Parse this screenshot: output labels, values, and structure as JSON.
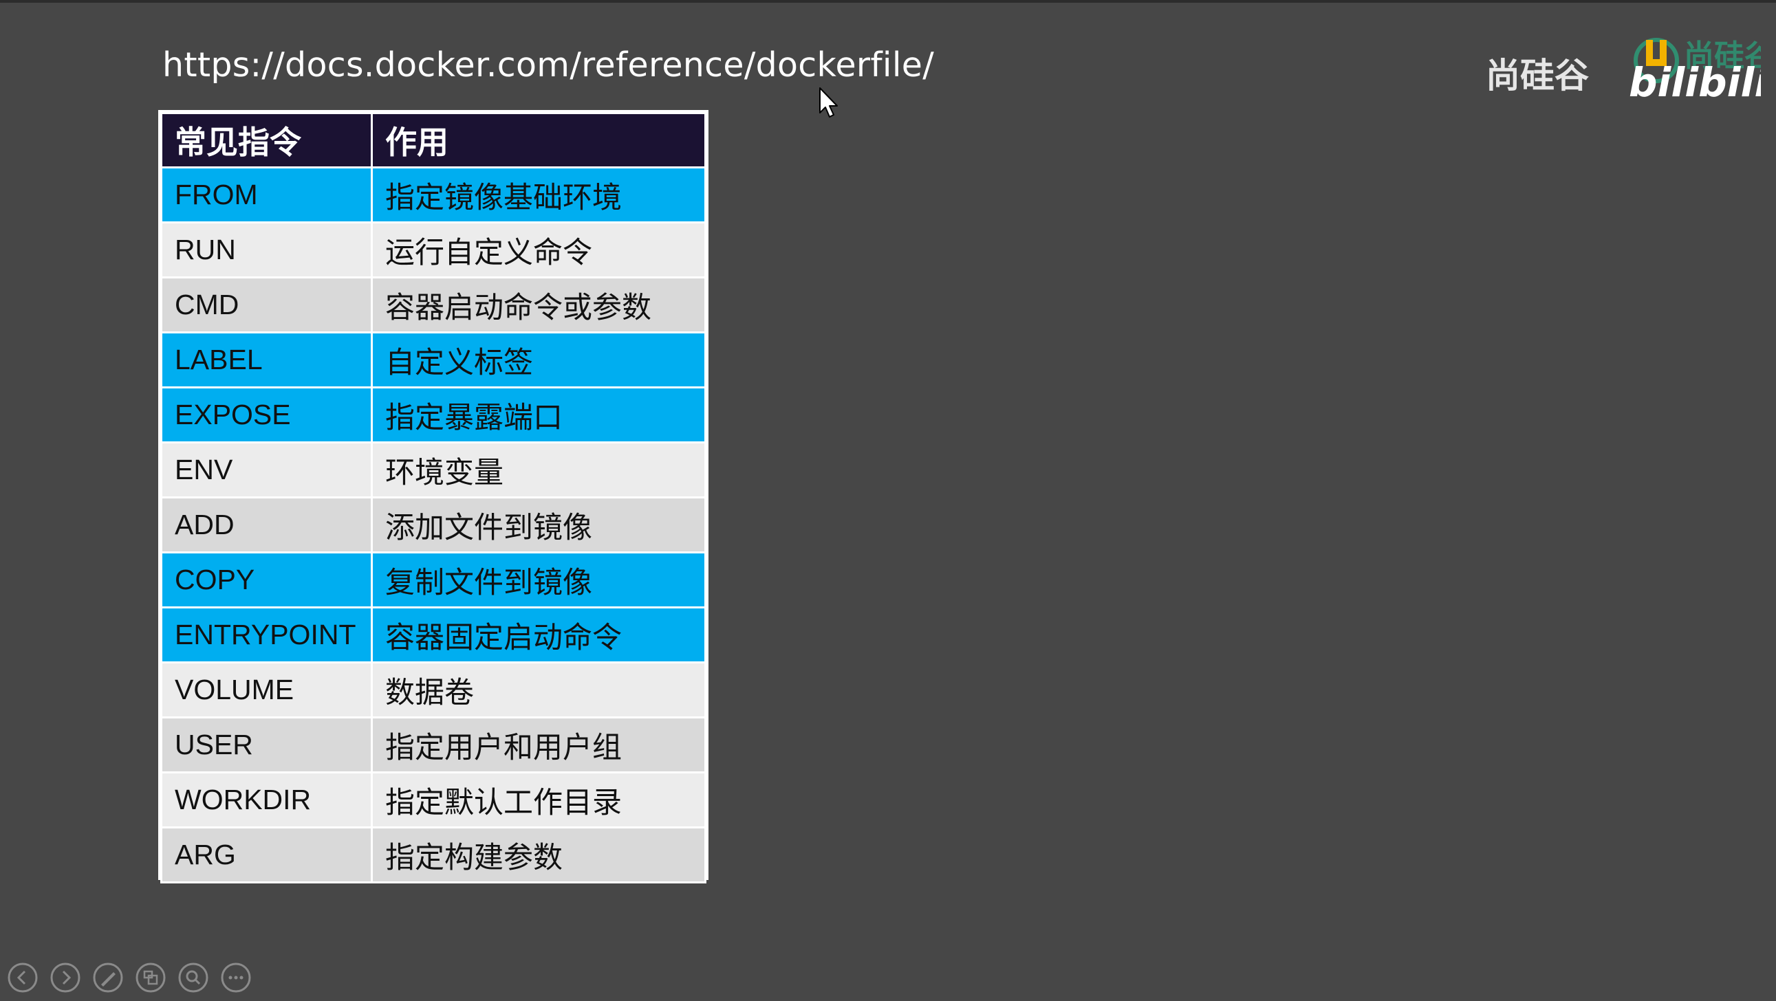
{
  "slide": {
    "url": "https://docs.docker.com/reference/dockerfile/"
  },
  "watermark": {
    "text": "尚硅谷",
    "brand": "bilibili",
    "brand_color": "#ffffff"
  },
  "table": {
    "headers": [
      "常见指令",
      "作用"
    ],
    "header_bg": "#1b1233",
    "highlight_color": "#00aef0",
    "rows": [
      {
        "cmd": "FROM",
        "desc": "指定镜像基础环境",
        "style": "blue"
      },
      {
        "cmd": "RUN",
        "desc": "运行自定义命令",
        "style": "light"
      },
      {
        "cmd": "CMD",
        "desc": "容器启动命令或参数",
        "style": "gray"
      },
      {
        "cmd": "LABEL",
        "desc": "自定义标签",
        "style": "blue"
      },
      {
        "cmd": "EXPOSE",
        "desc": "指定暴露端口",
        "style": "blue"
      },
      {
        "cmd": "ENV",
        "desc": "环境变量",
        "style": "light"
      },
      {
        "cmd": "ADD",
        "desc": "添加文件到镜像",
        "style": "gray"
      },
      {
        "cmd": "COPY",
        "desc": "复制文件到镜像",
        "style": "blue"
      },
      {
        "cmd": "ENTRYPOINT",
        "desc": "容器固定启动命令",
        "style": "blue"
      },
      {
        "cmd": "VOLUME",
        "desc": "数据卷",
        "style": "light"
      },
      {
        "cmd": "USER",
        "desc": "指定用户和用户组",
        "style": "gray"
      },
      {
        "cmd": "WORKDIR",
        "desc": "指定默认工作目录",
        "style": "light"
      },
      {
        "cmd": "ARG",
        "desc": "指定构建参数",
        "style": "gray"
      }
    ]
  },
  "toolbar": {
    "buttons": [
      {
        "name": "previous-slide-button",
        "icon": "chevron-left-icon"
      },
      {
        "name": "next-slide-button",
        "icon": "chevron-right-icon"
      },
      {
        "name": "pen-button",
        "icon": "pen-icon"
      },
      {
        "name": "slide-overview-button",
        "icon": "slides-icon"
      },
      {
        "name": "zoom-button",
        "icon": "magnifier-icon"
      },
      {
        "name": "more-options-button",
        "icon": "ellipsis-icon"
      }
    ]
  }
}
